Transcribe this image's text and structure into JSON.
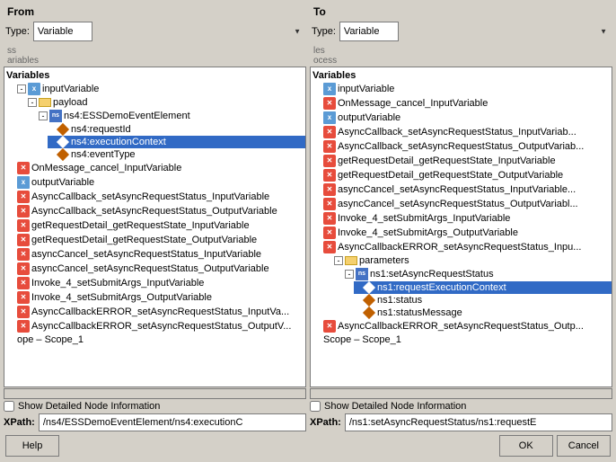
{
  "dialog": {
    "from_title": "From",
    "to_title": "To",
    "type_label": "Type:",
    "type_value": "Variable",
    "type_options": [
      "Variable"
    ],
    "from_tree": {
      "scroll_text": "ss",
      "scroll_text2": "ariables",
      "sections": [
        {
          "label": "Variables",
          "indent": 0,
          "type": "section"
        }
      ],
      "items": [
        {
          "label": "inputVariable",
          "indent": 1,
          "type": "var",
          "expanded": true
        },
        {
          "label": "payload",
          "indent": 2,
          "type": "folder",
          "expanded": true
        },
        {
          "label": "ns4:ESSDemoEventElement",
          "indent": 3,
          "type": "folder",
          "expanded": true
        },
        {
          "label": "ns4:requestId",
          "indent": 4,
          "type": "diamond"
        },
        {
          "label": "ns4:executionContext",
          "indent": 4,
          "type": "diamond",
          "selected": true
        },
        {
          "label": "ns4:eventType",
          "indent": 4,
          "type": "diamond"
        },
        {
          "label": "OnMessage_cancel_InputVariable",
          "indent": 1,
          "type": "var_x"
        },
        {
          "label": "outputVariable",
          "indent": 1,
          "type": "var"
        },
        {
          "label": "AsyncCallback_setAsyncRequestStatus_InputVariable",
          "indent": 1,
          "type": "var_x"
        },
        {
          "label": "AsyncCallback_setAsyncRequestStatus_OutputVariable",
          "indent": 1,
          "type": "var_x"
        },
        {
          "label": "getRequestDetail_getRequestState_InputVariable",
          "indent": 1,
          "type": "var_x"
        },
        {
          "label": "getRequestDetail_getRequestState_OutputVariable",
          "indent": 1,
          "type": "var_x"
        },
        {
          "label": "asyncCancel_setAsyncRequestStatus_InputVariable",
          "indent": 1,
          "type": "var_x"
        },
        {
          "label": "asyncCancel_setAsyncRequestStatus_OutputVariable",
          "indent": 1,
          "type": "var_x"
        },
        {
          "label": "Invoke_4_setSubmitArgs_InputVariable",
          "indent": 1,
          "type": "var_x"
        },
        {
          "label": "Invoke_4_setSubmitArgs_OutputVariable",
          "indent": 1,
          "type": "var_x"
        },
        {
          "label": "AsyncCallbackERROR_setAsyncRequestStatus_InputVa...",
          "indent": 1,
          "type": "var_x"
        },
        {
          "label": "AsyncCallbackERROR_setAsyncRequestStatus_OutputV...",
          "indent": 1,
          "type": "var_x"
        },
        {
          "label": "ope – Scope_1",
          "indent": 1,
          "type": "plain"
        }
      ]
    },
    "to_tree": {
      "scroll_text": "les",
      "scroll_text2": "ocess",
      "sections": [
        {
          "label": "Variables",
          "indent": 0,
          "type": "section"
        }
      ],
      "items": [
        {
          "label": "inputVariable",
          "indent": 1,
          "type": "var"
        },
        {
          "label": "OnMessage_cancel_InputVariable",
          "indent": 1,
          "type": "var_x"
        },
        {
          "label": "outputVariable",
          "indent": 1,
          "type": "var"
        },
        {
          "label": "AsyncCallback_setAsyncRequestStatus_InputVariab...",
          "indent": 1,
          "type": "var_x"
        },
        {
          "label": "AsyncCallback_setAsyncRequestStatus_OutputVariab...",
          "indent": 1,
          "type": "var_x"
        },
        {
          "label": "getRequestDetail_getRequestState_InputVariable",
          "indent": 1,
          "type": "var_x"
        },
        {
          "label": "getRequestDetail_getRequestState_OutputVariable",
          "indent": 1,
          "type": "var_x"
        },
        {
          "label": "asyncCancel_setAsyncRequestStatus_InputVariable...",
          "indent": 1,
          "type": "var_x"
        },
        {
          "label": "asyncCancel_setAsyncRequestStatus_OutputVariabl...",
          "indent": 1,
          "type": "var_x"
        },
        {
          "label": "Invoke_4_setSubmitArgs_InputVariable",
          "indent": 1,
          "type": "var_x"
        },
        {
          "label": "Invoke_4_setSubmitArgs_OutputVariable",
          "indent": 1,
          "type": "var_x"
        },
        {
          "label": "AsyncCallbackERROR_setAsyncRequestStatus_Inpu...",
          "indent": 1,
          "type": "var_x"
        },
        {
          "label": "parameters",
          "indent": 2,
          "type": "folder",
          "expanded": true
        },
        {
          "label": "ns1:setAsyncRequestStatus",
          "indent": 3,
          "type": "folder",
          "expanded": true
        },
        {
          "label": "ns1:requestExecutionContext",
          "indent": 4,
          "type": "diamond",
          "selected": true
        },
        {
          "label": "ns1:status",
          "indent": 4,
          "type": "diamond"
        },
        {
          "label": "ns1:statusMessage",
          "indent": 4,
          "type": "diamond"
        },
        {
          "label": "AsyncCallbackERROR_setAsyncRequestStatus_Outp...",
          "indent": 1,
          "type": "var_x"
        },
        {
          "label": "Scope – Scope_1",
          "indent": 1,
          "type": "plain"
        }
      ]
    },
    "from_checkbox_label": "Show Detailed Node Information",
    "to_checkbox_label": "Show Detailed Node Information",
    "from_xpath_label": "XPath:",
    "to_xpath_label": "XPath:",
    "from_xpath_value": "/ns4/ESSDemoEventElement/ns4:executionC",
    "to_xpath_value": "/ns1:setAsyncRequestStatus/ns1:requestE",
    "help_label": "Help",
    "ok_label": "OK",
    "cancel_label": "Cancel"
  }
}
